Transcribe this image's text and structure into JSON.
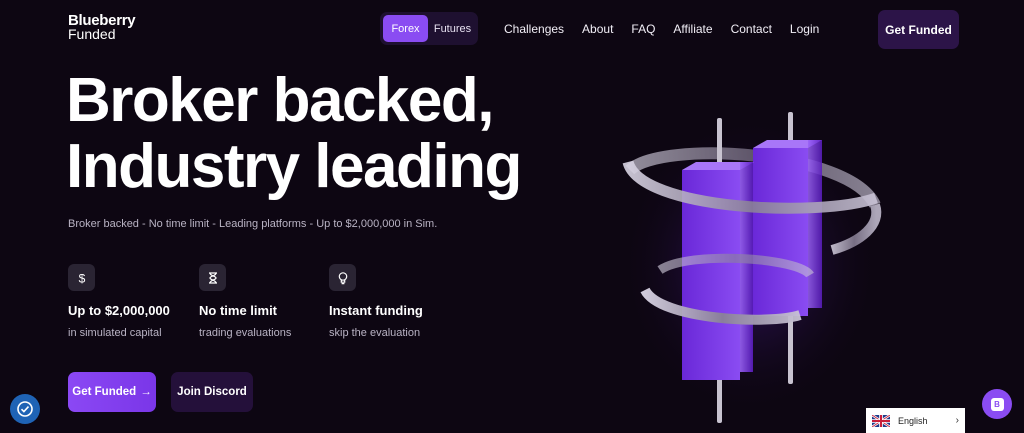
{
  "brand": {
    "line1": "Blueberry",
    "line2": "Funded"
  },
  "market_toggle": {
    "options": [
      "Forex",
      "Futures"
    ],
    "active": "Forex"
  },
  "nav": {
    "items": [
      "Challenges",
      "About",
      "FAQ",
      "Affiliate",
      "Contact",
      "Login"
    ]
  },
  "header": {
    "cta_label": "Get Funded"
  },
  "hero": {
    "title_line1": "Broker backed,",
    "title_line2": "Industry leading",
    "subtitle": "Broker backed - No time limit - Leading platforms - Up to $2,000,000 in Sim."
  },
  "features": [
    {
      "icon": "dollar-icon",
      "title": "Up to $2,000,000",
      "subtitle": "in simulated capital"
    },
    {
      "icon": "hourglass-icon",
      "title": "No time limit",
      "subtitle": "trading evaluations"
    },
    {
      "icon": "lightbulb-icon",
      "title": "Instant funding",
      "subtitle": "skip the evaluation"
    }
  ],
  "actions": {
    "primary_label": "Get Funded",
    "primary_arrow": "→",
    "secondary_label": "Join Discord"
  },
  "language": {
    "selected": "English"
  },
  "chat_widget": {
    "letter": "B"
  },
  "colors": {
    "background": "#0d0612",
    "accent": "#8a4cf2",
    "button_dark": "#2c1448"
  }
}
